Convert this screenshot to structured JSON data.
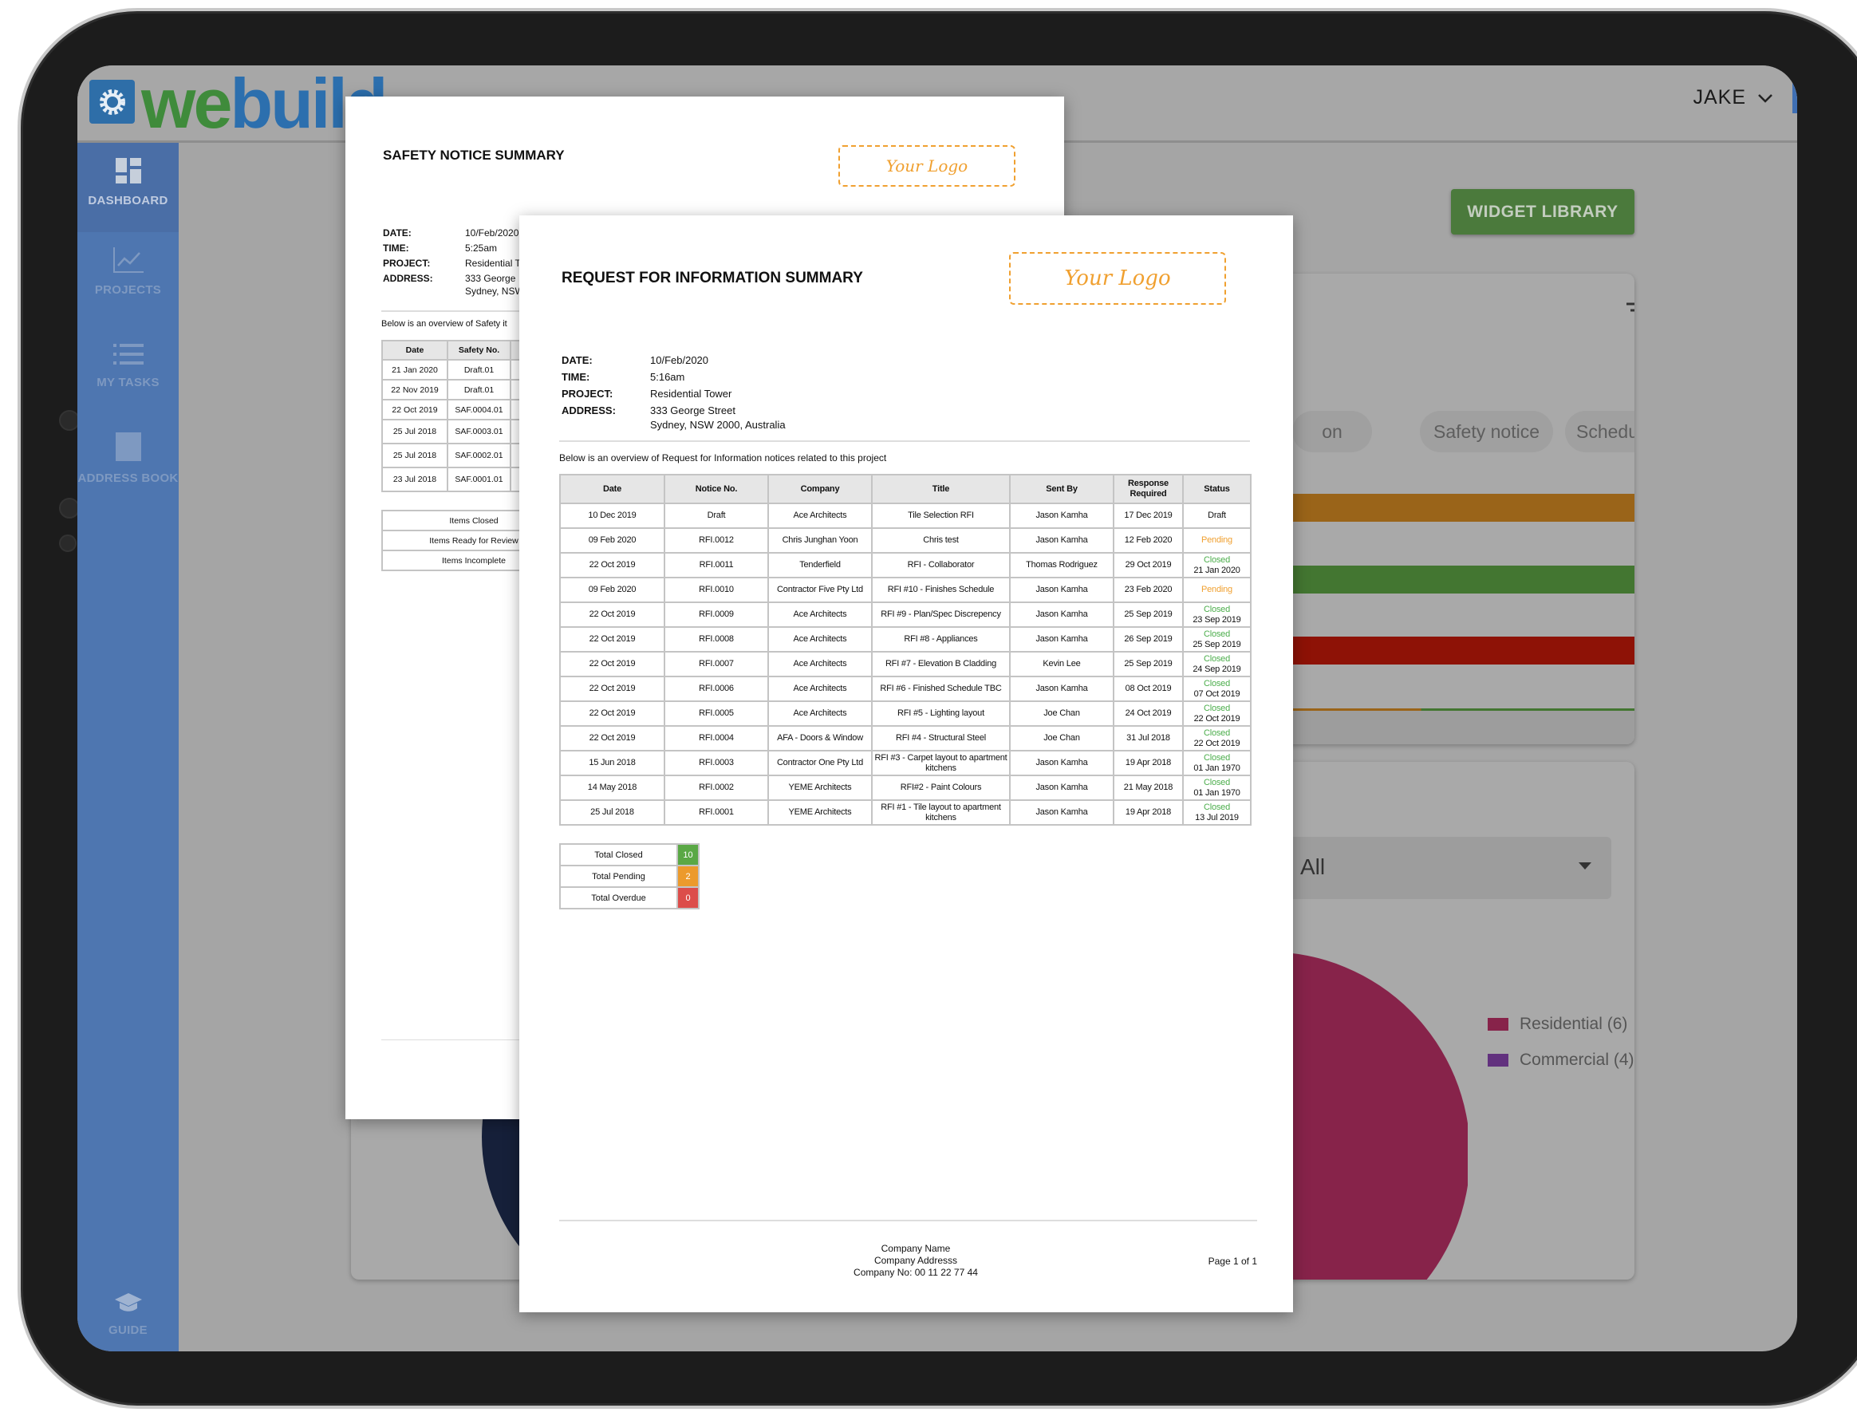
{
  "app": {
    "logo_we": "we",
    "logo_build": "build",
    "user_name": "JAKE",
    "sidebar": [
      {
        "label": "DASHBOARD",
        "icon": "dashboard-icon",
        "active": true
      },
      {
        "label": "PROJECTS",
        "icon": "chart-line-icon"
      },
      {
        "label": "MY TASKS",
        "icon": "list-icon"
      },
      {
        "label": "ADDRESS BOOK",
        "icon": "book-icon"
      },
      {
        "label": "GUIDE",
        "icon": "graduation-cap-icon"
      }
    ],
    "widget_library_label": "WIDGET LIBRARY",
    "chips": [
      "on",
      "Safety notice",
      "Schedule"
    ],
    "bar_colors": {
      "orange": "#9a6419",
      "green": "#437631",
      "red": "#8e1206"
    },
    "filter_value": "All",
    "legend": [
      {
        "label": "Residential (6)",
        "color": "#87234a"
      },
      {
        "label": "Commercial (4)",
        "color": "#62317e"
      }
    ]
  },
  "safety_doc": {
    "title": "SAFETY NOTICE SUMMARY",
    "logo_placeholder": "Your Logo",
    "meta": [
      {
        "label": "DATE:",
        "value": "10/Feb/2020"
      },
      {
        "label": "TIME:",
        "value": "5:25am"
      },
      {
        "label": "PROJECT:",
        "value": "Residential T"
      },
      {
        "label": "ADDRESS:",
        "value": "333 George",
        "value2": "Sydney, NSW"
      }
    ],
    "intro": "Below is an overview of Safety it",
    "columns": [
      "Date",
      "Safety No."
    ],
    "rows": [
      [
        "21 Jan 2020",
        "Draft.01"
      ],
      [
        "22 Nov 2019",
        "Draft.01"
      ],
      [
        "22 Oct 2019",
        "SAF.0004.01"
      ],
      [
        "25 Jul 2018",
        "SAF.0003.01"
      ],
      [
        "25 Jul 2018",
        "SAF.0002.01"
      ],
      [
        "23 Jul 2018",
        "SAF.0001.01"
      ]
    ],
    "items": [
      "Items Closed",
      "Items Ready for Review",
      "Items Incomplete"
    ]
  },
  "rfi_doc": {
    "title": "REQUEST FOR INFORMATION SUMMARY",
    "logo_placeholder": "Your Logo",
    "meta": [
      {
        "label": "DATE:",
        "value": "10/Feb/2020"
      },
      {
        "label": "TIME:",
        "value": "5:16am"
      },
      {
        "label": "PROJECT:",
        "value": "Residential Tower"
      },
      {
        "label": "ADDRESS:",
        "value": "333 George Street",
        "value2": "Sydney, NSW 2000, Australia"
      }
    ],
    "intro": "Below is an overview of Request for Information notices related to this project",
    "columns": [
      "Date",
      "Notice No.",
      "Company",
      "Title",
      "Sent By",
      "Response Required",
      "Status"
    ],
    "rows": [
      [
        "10 Dec 2019",
        "Draft",
        "Ace Architects",
        "Tile Selection RFI",
        "Jason Kamha",
        "17 Dec 2019",
        "Draft",
        ""
      ],
      [
        "09 Feb 2020",
        "RFI.0012",
        "Chris Junghan Yoon",
        "Chris test",
        "Jason Kamha",
        "12 Feb 2020",
        "Pending",
        ""
      ],
      [
        "22 Oct 2019",
        "RFI.0011",
        "Tenderfield",
        "RFI - Collaborator",
        "Thomas Rodriguez",
        "29 Oct 2019",
        "Closed",
        "21 Jan 2020"
      ],
      [
        "09 Feb 2020",
        "RFI.0010",
        "Contractor Five Pty Ltd",
        "RFI #10 - Finishes Schedule",
        "Jason Kamha",
        "23 Feb 2020",
        "Pending",
        ""
      ],
      [
        "22 Oct 2019",
        "RFI.0009",
        "Ace Architects",
        "RFI #9 - Plan/Spec Discrepency",
        "Jason Kamha",
        "25 Sep 2019",
        "Closed",
        "23 Sep 2019"
      ],
      [
        "22 Oct 2019",
        "RFI.0008",
        "Ace Architects",
        "RFI #8 - Appliances",
        "Jason Kamha",
        "26 Sep 2019",
        "Closed",
        "25 Sep 2019"
      ],
      [
        "22 Oct 2019",
        "RFI.0007",
        "Ace Architects",
        "RFI #7 - Elevation B Cladding",
        "Kevin Lee",
        "25 Sep 2019",
        "Closed",
        "24 Sep 2019"
      ],
      [
        "22 Oct 2019",
        "RFI.0006",
        "Ace Architects",
        "RFI #6 - Finished Schedule TBC",
        "Jason Kamha",
        "08 Oct 2019",
        "Closed",
        "07 Oct 2019"
      ],
      [
        "22 Oct 2019",
        "RFI.0005",
        "Ace Architects",
        "RFI #5 - Lighting layout",
        "Joe Chan",
        "24 Oct 2019",
        "Closed",
        "22 Oct 2019"
      ],
      [
        "22 Oct 2019",
        "RFI.0004",
        "AFA - Doors & Window",
        "RFI #4 - Structural Steel",
        "Joe Chan",
        "31 Jul 2018",
        "Closed",
        "22 Oct 2019"
      ],
      [
        "15 Jun 2018",
        "RFI.0003",
        "Contractor One Pty Ltd",
        "RFI #3 - Carpet layout to apartment kitchens",
        "Jason Kamha",
        "19 Apr 2018",
        "Closed",
        "01 Jan 1970"
      ],
      [
        "14 May 2018",
        "RFI.0002",
        "YEME Architects",
        "RFI#2 - Paint Colours",
        "Jason Kamha",
        "21 May 2018",
        "Closed",
        "01 Jan 1970"
      ],
      [
        "25 Jul 2018",
        "RFI.0001",
        "YEME Architects",
        "RFI #1 - Tile layout to apartment kitchens",
        "Jason Kamha",
        "19 Apr 2018",
        "Closed",
        "13 Jul 2019"
      ]
    ],
    "totals": [
      {
        "label": "Total Closed",
        "value": "10",
        "color": "#5aa845"
      },
      {
        "label": "Total Pending",
        "value": "2",
        "color": "#ec9a2c"
      },
      {
        "label": "Total Overdue",
        "value": "0",
        "color": "#dc4d4a"
      }
    ],
    "footer": {
      "company_name": "Company Name",
      "company_address": "Company Addresss",
      "company_no": "Company No: 00 11 22 77 44",
      "page": "Page 1 of 1"
    }
  }
}
